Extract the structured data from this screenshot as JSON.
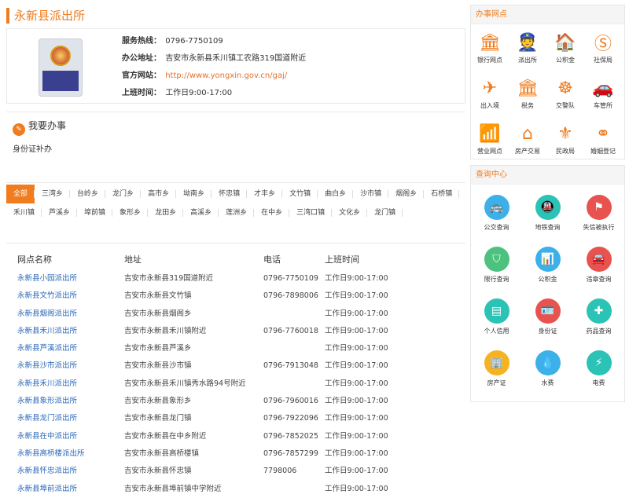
{
  "page_title": "永新县派出所",
  "info": {
    "phone_label": "服务热线：",
    "phone": "0796-7750109",
    "address_label": "办公地址：",
    "address": "吉安市永新县禾川镇工农路319国道附近",
    "website_label": "官方网站：",
    "website": "http://www.yongxin.gov.cn/gaj/",
    "hours_label": "上班时间：",
    "hours": "工作日9:00-17:00"
  },
  "service": {
    "title": "我要办事",
    "item": "身份证补办"
  },
  "filters": [
    "全部",
    "三湾乡",
    "台岭乡",
    "龙门乡",
    "高市乡",
    "坳南乡",
    "怀忠镇",
    "才丰乡",
    "文竹镇",
    "曲白乡",
    "沙市镇",
    "烟阁乡",
    "石桥镇",
    "禾川镇",
    "芦溪乡",
    "埠前镇",
    "象形乡",
    "龙田乡",
    "高溪乡",
    "莲洲乡",
    "在中乡",
    "三湾口镇",
    "文化乡",
    "龙门镇"
  ],
  "table": {
    "headers": [
      "网点名称",
      "地址",
      "电话",
      "上班时间"
    ],
    "rows": [
      [
        "永新县小园派出所",
        "吉安市永新县319国道附近",
        "0796-7750109",
        "工作日9:00-17:00"
      ],
      [
        "永新县文竹派出所",
        "吉安市永新县文竹镇",
        "0796-7898006",
        "工作日9:00-17:00"
      ],
      [
        "永新县烟阁派出所",
        "吉安市永新县烟阁乡",
        "",
        "工作日9:00-17:00"
      ],
      [
        "永新县禾川派出所",
        "吉安市永新县禾川镇附近",
        "0796-7760018",
        "工作日9:00-17:00"
      ],
      [
        "永新县芦溪派出所",
        "吉安市永新县芦溪乡",
        "",
        "工作日9:00-17:00"
      ],
      [
        "永新县沙市派出所",
        "吉安市永新县沙市镇",
        "0796-7913048",
        "工作日9:00-17:00"
      ],
      [
        "永新县禾川派出所",
        "吉安市永新县禾川镇秀水路94号附近",
        "",
        "工作日9:00-17:00"
      ],
      [
        "永新县象形派出所",
        "吉安市永新县象形乡",
        "0796-7960016",
        "工作日9:00-17:00"
      ],
      [
        "永新县龙门派出所",
        "吉安市永新县龙门镇",
        "0796-7922096",
        "工作日9:00-17:00"
      ],
      [
        "永新县在中派出所",
        "吉安市永新县在中乡附近",
        "0796-7852025",
        "工作日9:00-17:00"
      ],
      [
        "永新县高桥楼派出所",
        "吉安市永新县高桥楼镇",
        "0796-7857299",
        "工作日9:00-17:00"
      ],
      [
        "永新县怀忠派出所",
        "吉安市永新县怀忠镇",
        "7798006",
        "工作日9:00-17:00"
      ],
      [
        "永新县埠前派出所",
        "吉安市永新县埠前镇中学附近",
        "",
        "工作日9:00-17:00"
      ]
    ]
  },
  "banshi": {
    "title": "办事网点",
    "items": [
      {
        "label": "银行网点",
        "icon": "bank-icon",
        "glyph": "🏛"
      },
      {
        "label": "派出所",
        "icon": "police-icon",
        "glyph": "👮"
      },
      {
        "label": "公积金",
        "icon": "fund-icon",
        "glyph": "🏠"
      },
      {
        "label": "社保局",
        "icon": "social-security-icon",
        "glyph": "Ⓢ"
      },
      {
        "label": "出入境",
        "icon": "exit-entry-icon",
        "glyph": "✈"
      },
      {
        "label": "税务",
        "icon": "tax-icon",
        "glyph": "🏛"
      },
      {
        "label": "交警队",
        "icon": "traffic-police-icon",
        "glyph": "☸"
      },
      {
        "label": "车管所",
        "icon": "car-office-icon",
        "glyph": "🚗"
      },
      {
        "label": "营业网点",
        "icon": "service-hall-icon",
        "glyph": "📶"
      },
      {
        "label": "房产交易",
        "icon": "house-icon",
        "glyph": "⌂"
      },
      {
        "label": "民政局",
        "icon": "civil-affairs-icon",
        "glyph": "⚜"
      },
      {
        "label": "婚姻登记",
        "icon": "marriage-icon",
        "glyph": "⚭"
      }
    ]
  },
  "chaxun": {
    "title": "查询中心",
    "items": [
      {
        "label": "公交查询",
        "icon": "bus-icon",
        "color": "#3cb0e8",
        "glyph": "🚌"
      },
      {
        "label": "地铁查询",
        "icon": "metro-icon",
        "color": "#2bc3b5",
        "glyph": "🚇"
      },
      {
        "label": "失信被执行",
        "icon": "dishonest-icon",
        "color": "#e8534f",
        "glyph": "⚑"
      },
      {
        "label": "限行查询",
        "icon": "restriction-icon",
        "color": "#4cc27e",
        "glyph": "⛉"
      },
      {
        "label": "公积金",
        "icon": "fund-icon",
        "color": "#3cb0e8",
        "glyph": "📊"
      },
      {
        "label": "违章查询",
        "icon": "violation-icon",
        "color": "#e8534f",
        "glyph": "🚘"
      },
      {
        "label": "个人信用",
        "icon": "credit-icon",
        "color": "#2bc3b5",
        "glyph": "▤"
      },
      {
        "label": "身份证",
        "icon": "id-card-icon",
        "color": "#e8534f",
        "glyph": "🪪"
      },
      {
        "label": "药品查询",
        "icon": "medicine-icon",
        "color": "#2bc3b5",
        "glyph": "✚"
      },
      {
        "label": "房产证",
        "icon": "property-icon",
        "color": "#f5b31f",
        "glyph": "🏢"
      },
      {
        "label": "水费",
        "icon": "water-icon",
        "color": "#3cb0e8",
        "glyph": "💧"
      },
      {
        "label": "电费",
        "icon": "electric-icon",
        "color": "#2bc3b5",
        "glyph": "⚡"
      }
    ]
  }
}
